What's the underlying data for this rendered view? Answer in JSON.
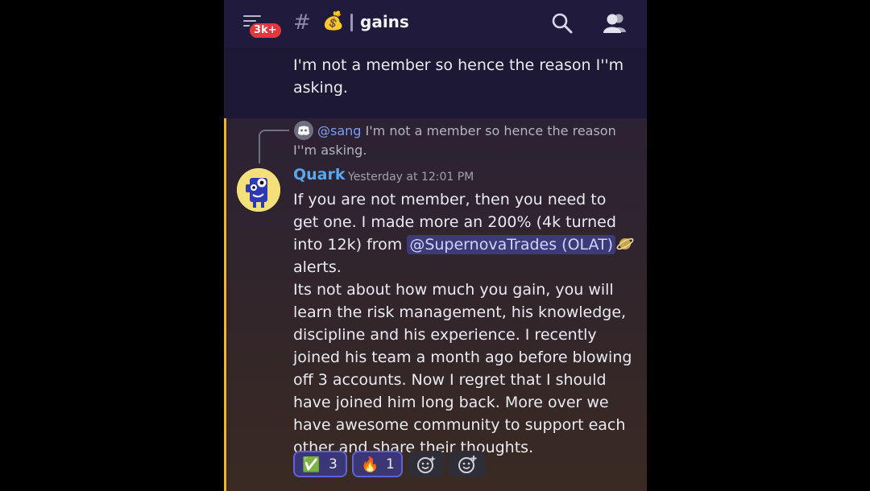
{
  "header": {
    "badge": "3k+",
    "channel_emoji": "💰",
    "channel_name": "gains"
  },
  "previous_message": {
    "text": "I'm not a member so hence the reason I''m asking."
  },
  "message": {
    "reply": {
      "mention": "@sang",
      "text": "I'm not a member so hence the reason I''m asking."
    },
    "author": "Quark",
    "timestamp": "Yesterday at 12:01 PM",
    "body_part1": "If you are not member, then you need to get one. I made more an 200% (4k turned into 12k) from ",
    "mention": "@SupernovaTrades (OLAT)",
    "body_part2": " alerts.",
    "body_part3": "Its not about how much you gain, you will learn the risk management, his knowledge, discipline and his experience. I recently joined his team a month ago before blowing off 3 accounts. Now I regret that I should have joined him long back. More over we have awesome community to support each other and share their thoughts."
  },
  "reactions": [
    {
      "emoji": "✅",
      "count": "3"
    },
    {
      "emoji": "🔥",
      "count": "1"
    }
  ],
  "colors": {
    "accent_bar": "#f0b232",
    "author": "#5aa7f0",
    "badge": "#e0383c"
  }
}
